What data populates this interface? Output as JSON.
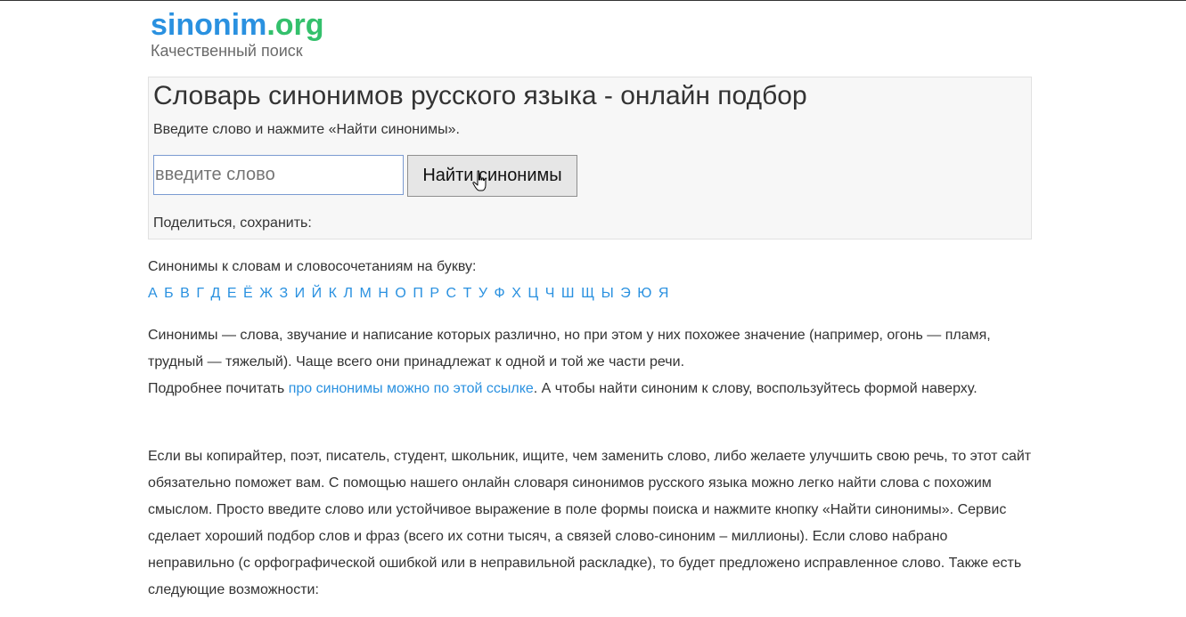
{
  "header": {
    "logo_part1": "sinonim",
    "logo_part2": ".org",
    "tagline": "Качественный поиск"
  },
  "search": {
    "title": "Словарь синонимов русского языка - онлайн подбор",
    "instructions": "Введите слово и нажмите «Найти синонимы».",
    "placeholder": "введите слово",
    "value": "",
    "button_label": "Найти синонимы",
    "share_label": "Поделиться, сохранить:"
  },
  "alphabet": {
    "label": "Синонимы к словам и словосочетаниям на букву:",
    "letters": [
      "А",
      "Б",
      "В",
      "Г",
      "Д",
      "Е",
      "Ё",
      "Ж",
      "З",
      "И",
      "Й",
      "К",
      "Л",
      "М",
      "Н",
      "О",
      "П",
      "Р",
      "С",
      "Т",
      "У",
      "Ф",
      "Х",
      "Ц",
      "Ч",
      "Ш",
      "Щ",
      "Ы",
      "Э",
      "Ю",
      "Я"
    ]
  },
  "content": {
    "p1_text1": "Синонимы — слова, звучание и написание которых различно, но при этом у них похожее значение (например, огонь — пламя, трудный — тяжелый). Чаще всего они принадлежат к одной и той же части речи.",
    "p1_text2": "Подробнее почитать ",
    "p1_link": "про синонимы можно по этой ссылке",
    "p1_text3": ". А чтобы найти синоним к слову, воспользуйтесь формой наверху.",
    "p2_text": "Если вы копирайтер, поэт, писатель, студент, школьник, ищите, чем заменить слово, либо желаете улучшить свою речь, то этот сайт обязательно поможет вам. С помощью нашего онлайн словаря синонимов русского языка можно легко найти слова с похожим смыслом. Просто введите слово или устойчивое выражение в поле формы поиска и нажмите кнопку «Найти синонимы». Сервис сделает хороший подбор слов и фраз (всего их сотни тысяч, а связей слово-синоним – миллионы). Если слово набрано неправильно (с орфографической ошибкой или в неправильной раскладке), то будет предложено исправленное слово. Также есть следующие возможности:"
  },
  "colors": {
    "link": "#2a91e0",
    "logo_green": "#34c06c",
    "panel_bg": "#f7f7f7"
  },
  "icons": {
    "cursor": "hand-pointer-icon"
  }
}
